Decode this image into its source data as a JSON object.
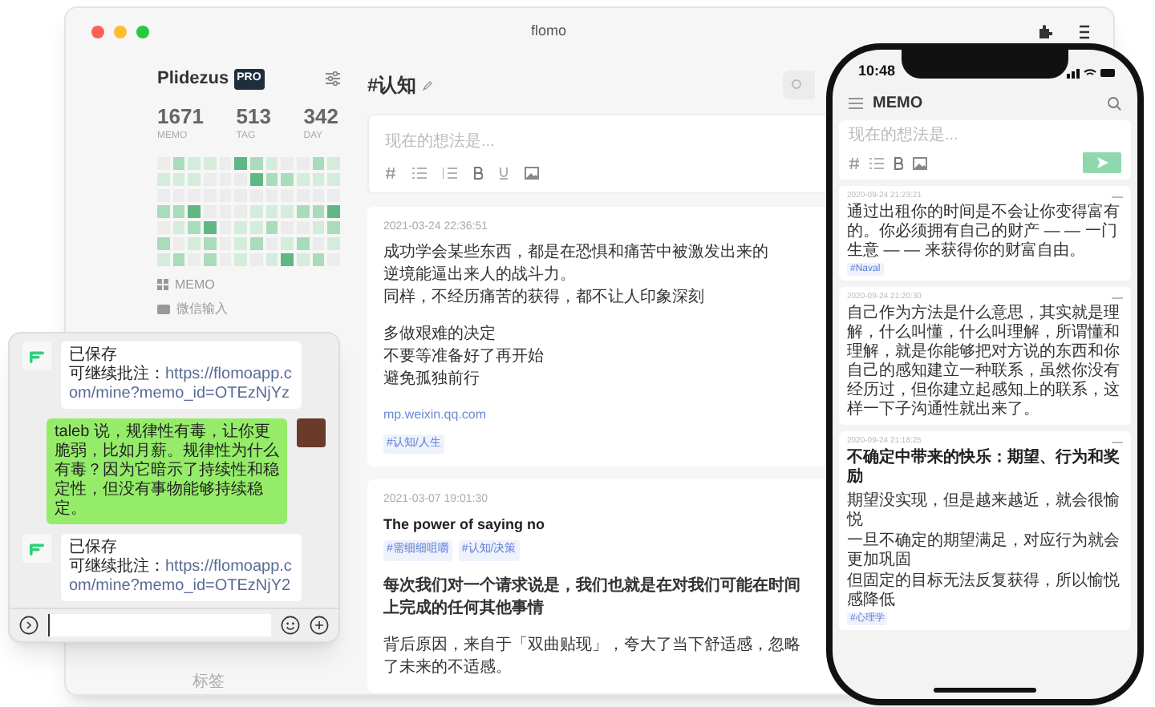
{
  "window": {
    "title": "flomo"
  },
  "sidebar": {
    "user": "Plidezus",
    "badge": "PRO",
    "stats": [
      {
        "value": "1671",
        "label": "MEMO"
      },
      {
        "value": "513",
        "label": "TAG"
      },
      {
        "value": "342",
        "label": "DAY"
      }
    ],
    "nav": [
      {
        "label": "MEMO",
        "kind": "grid"
      },
      {
        "label": "微信输入",
        "kind": "keyboard"
      }
    ],
    "footer": "标签"
  },
  "main": {
    "title": "#认知",
    "editor": {
      "placeholder": "现在的想法是..."
    },
    "memos": [
      {
        "date": "2021-03-24 22:36:51",
        "paragraphs": [
          {
            "lines": [
              "成功学会某些东西，都是在恐惧和痛苦中被激发出来的",
              "逆境能逼出来人的战斗力。",
              "同样，不经历痛苦的获得，都不让人印象深刻"
            ],
            "bold": false
          },
          {
            "lines": [
              "多做艰难的决定",
              "不要等准备好了再开始",
              "避免孤独前行"
            ],
            "bold": false
          }
        ],
        "link": "mp.weixin.qq.com",
        "tags": [
          "#认知/人生"
        ]
      },
      {
        "date": "2021-03-07 19:01:30",
        "title": "The power of saying no",
        "tags": [
          "#需细细咀嚼",
          "#认知/决策"
        ],
        "paragraphs": [
          {
            "lines": [
              "每次我们对一个请求说是，我们也就是在对我们可能在时间上完成的任何其他事情"
            ],
            "bold": true
          },
          {
            "lines": [
              "背后原因，来自于「双曲贴现」，夸大了当下舒适感，忽略了未来的不适感。"
            ],
            "bold": false
          }
        ]
      }
    ]
  },
  "chat": {
    "messages": [
      {
        "kind": "bot",
        "status": "已保存",
        "note": "可继续批注：",
        "link": "https://flomoapp.com/mine?memo_id=OTEzNjYz"
      },
      {
        "kind": "user",
        "text": "taleb 说，规律性有毒，让你更脆弱，比如月薪。规律性为什么有毒？因为它暗示了持续性和稳定性，但没有事物能够持续稳定。"
      },
      {
        "kind": "bot",
        "status": "已保存",
        "note": "可继续批注：",
        "link": "https://flomoapp.com/mine?memo_id=OTEzNjY2"
      }
    ]
  },
  "phone": {
    "time": "10:48",
    "title": "MEMO",
    "editor": {
      "placeholder": "现在的想法是..."
    },
    "memos": [
      {
        "date": "2020-09-24 21:23:21",
        "lines": [
          "通过出租你的时间是不会让你变得富有的。你必须拥有自己的财产 — — 一门生意 — — 来获得你的财富自由。"
        ],
        "tags": [
          "#Naval"
        ]
      },
      {
        "date": "2020-09-24 21:20:30",
        "lines": [
          "自己作为方法是什么意思，其实就是理解，什么叫懂，什么叫理解，所谓懂和理解，就是你能够把对方说的东西和你自己的感知建立一种联系，虽然你没有经历过，但你建立起感知上的联系，这样一下子沟通性就出来了。"
        ]
      },
      {
        "date": "2020-09-24 21:18:25",
        "title": "不确定中带来的快乐：期望、行为和奖励",
        "lines": [
          "期望没实现，但是越来越近，就会很愉悦",
          "一旦不确定的期望满足，对应行为就会更加巩固",
          "但固定的目标无法反复获得，所以愉悦感降低"
        ],
        "tags": [
          "#心理学"
        ]
      }
    ]
  }
}
